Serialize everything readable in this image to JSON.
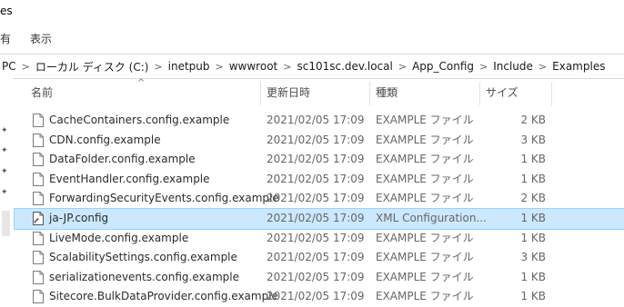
{
  "window": {
    "title_fragment": "es"
  },
  "ribbon": {
    "left_fragment": "有",
    "view_tab": "表示"
  },
  "address_bar": {
    "crumbs": [
      "PC",
      "ローカル ディスク (C:)",
      "inetpub",
      "wwwroot",
      "sc101sc.dev.local",
      "App_Config",
      "Include",
      "Examples"
    ],
    "separator": ">"
  },
  "columns": {
    "name": "名前",
    "date": "更新日時",
    "type": "種類",
    "size": "サイズ"
  },
  "files": [
    {
      "name": "CacheContainers.config.example",
      "date": "2021/02/05 17:09",
      "type": "EXAMPLE ファイル",
      "size": "2 KB",
      "icon": "document-icon",
      "selected": false
    },
    {
      "name": "CDN.config.example",
      "date": "2021/02/05 17:09",
      "type": "EXAMPLE ファイル",
      "size": "3 KB",
      "icon": "document-icon",
      "selected": false
    },
    {
      "name": "DataFolder.config.example",
      "date": "2021/02/05 17:09",
      "type": "EXAMPLE ファイル",
      "size": "1 KB",
      "icon": "document-icon",
      "selected": false
    },
    {
      "name": "EventHandler.config.example",
      "date": "2021/02/05 17:09",
      "type": "EXAMPLE ファイル",
      "size": "1 KB",
      "icon": "document-icon",
      "selected": false
    },
    {
      "name": "ForwardingSecurityEvents.config.example",
      "date": "2021/02/05 17:09",
      "type": "EXAMPLE ファイル",
      "size": "2 KB",
      "icon": "document-icon",
      "selected": false
    },
    {
      "name": "ja-JP.config",
      "date": "2021/02/05 17:09",
      "type": "XML Configuration...",
      "size": "1 KB",
      "icon": "config-file-icon",
      "selected": true
    },
    {
      "name": "LiveMode.config.example",
      "date": "2021/02/05 17:09",
      "type": "EXAMPLE ファイル",
      "size": "1 KB",
      "icon": "document-icon",
      "selected": false
    },
    {
      "name": "ScalabilitySettings.config.example",
      "date": "2021/02/05 17:09",
      "type": "EXAMPLE ファイル",
      "size": "3 KB",
      "icon": "document-icon",
      "selected": false
    },
    {
      "name": "serializationevents.config.example",
      "date": "2021/02/05 17:09",
      "type": "EXAMPLE ファイル",
      "size": "1 KB",
      "icon": "document-icon",
      "selected": false
    },
    {
      "name": "Sitecore.BulkDataProvider.config.example",
      "date": "2021/02/05 17:09",
      "type": "EXAMPLE ファイル",
      "size": "1 KB",
      "icon": "document-icon",
      "selected": false
    }
  ],
  "colors": {
    "selection_bg": "#cce8ff",
    "selection_border": "#99d1ff",
    "header_text": "#4c4c4c"
  }
}
